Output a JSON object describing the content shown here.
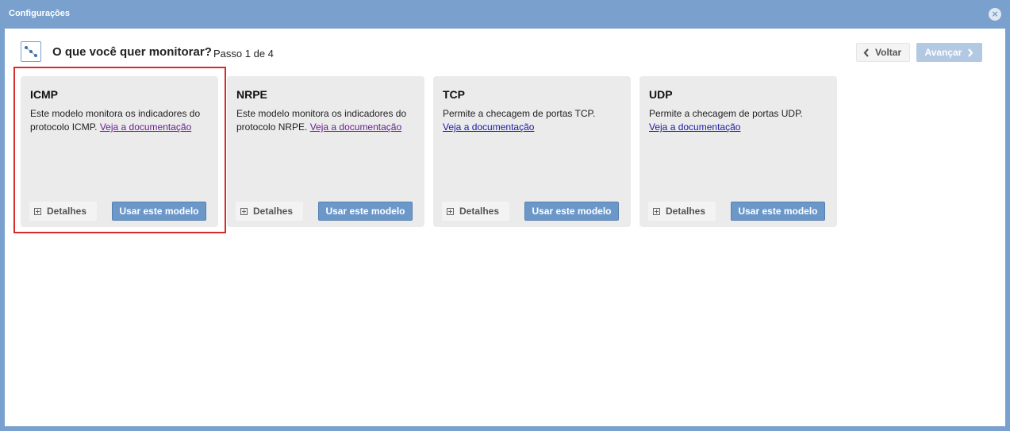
{
  "window": {
    "title": "Configurações",
    "close_icon": "close-circle-icon"
  },
  "header": {
    "icon": "network-nodes-icon",
    "title": "O que você quer monitorar?",
    "step": "Passo 1 de 4",
    "back_label": "Voltar",
    "next_label": "Avançar"
  },
  "cards": [
    {
      "title": "ICMP",
      "desc_before": "Este modelo monitora os indicadores do protocolo ICMP. ",
      "link": "Veja a documentação",
      "details_label": "Detalhes",
      "use_label": "Usar este modelo"
    },
    {
      "title": "NRPE",
      "desc_before": "Este modelo monitora os indicadores do protocolo NRPE. ",
      "link": "Veja a documentação",
      "details_label": "Detalhes",
      "use_label": "Usar este modelo"
    },
    {
      "title": "TCP",
      "desc_before": "Permite a checagem de portas TCP.",
      "link": "Veja a documentação",
      "details_label": "Detalhes",
      "use_label": "Usar este modelo"
    },
    {
      "title": "UDP",
      "desc_before": "Permite a checagem de portas UDP.",
      "link": "Veja a documentação",
      "details_label": "Detalhes",
      "use_label": "Usar este modelo"
    }
  ],
  "colors": {
    "titlebar": "#7aa0cd",
    "primary_button": "#6b97c9",
    "highlight": "#d42b2b"
  }
}
